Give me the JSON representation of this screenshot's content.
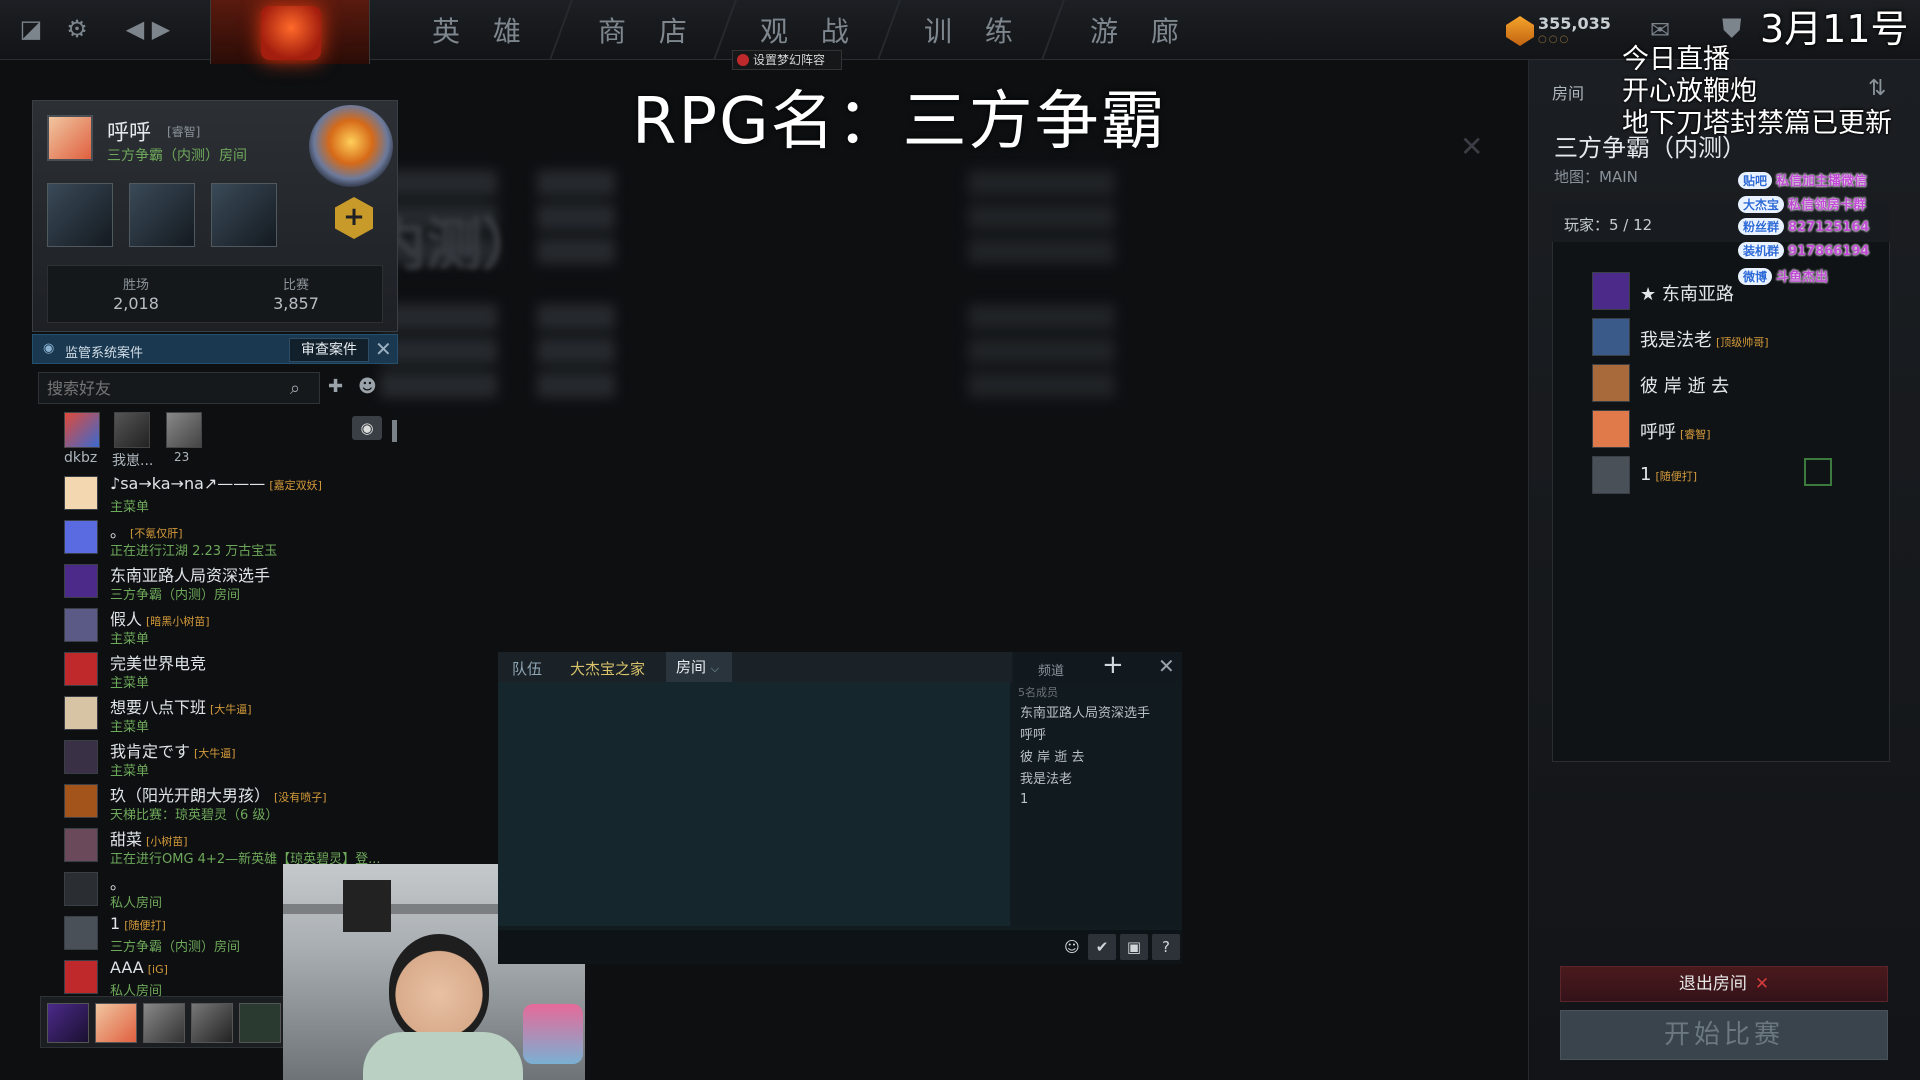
{
  "topbar": {
    "nav": [
      "英 雄",
      "商 店",
      "观 战",
      "训 练",
      "游 廊"
    ],
    "notice": "设置梦幻阵容",
    "currency": "355,035",
    "currency_dots": "○○○"
  },
  "overlay": {
    "date": "3月11号",
    "title": "RPG名：三方争霸",
    "live_lines": [
      "今日直播",
      "开心放鞭炮",
      "地下刀塔封禁篇已更新"
    ]
  },
  "profile": {
    "name": "呼呼",
    "tag": "[睿智]",
    "status": "三方争霸（内测）房间",
    "wins_label": "胜场",
    "wins": "2,018",
    "matches_label": "比赛",
    "matches": "3,857"
  },
  "overwatch": {
    "label": "监管系统案件",
    "button": "审查案件"
  },
  "search": {
    "placeholder": "搜索好友"
  },
  "party": [
    {
      "name": "dkbz"
    },
    {
      "name": "我崽..."
    },
    {
      "name": "23"
    }
  ],
  "friends": [
    {
      "name": "♪sa→ka→na↗———",
      "tag": "[嘉定双妖]",
      "status": "主菜单",
      "color": "#f3d7b0"
    },
    {
      "name": "。",
      "tag": "[不氪仅肝]",
      "status": "正在进行江湖 2.23 万古宝玉",
      "color": "#5a6ae0"
    },
    {
      "name": "东南亚路人局资深选手",
      "tag": "",
      "status": "三方争霸（内测）房间",
      "color": "#4b2a8a"
    },
    {
      "name": "假人",
      "tag": "[暗黑小树苗]",
      "status": "主菜单",
      "color": "#5b5a86"
    },
    {
      "name": "完美世界电竞",
      "tag": "",
      "status": "主菜单",
      "color": "#c0292b"
    },
    {
      "name": "想要八点下班",
      "tag": "[大牛逼]",
      "status": "主菜单",
      "color": "#d6c4a4"
    },
    {
      "name": "我肯定です",
      "tag": "[大牛逼]",
      "status": "主菜单",
      "color": "#3a3046"
    },
    {
      "name": "玖（阳光开朗大男孩）",
      "tag": "[没有喷子]",
      "status": "天梯比赛：琼英碧灵（6 级）",
      "color": "#a2541a"
    },
    {
      "name": "甜菜",
      "tag": "[小树苗]",
      "status": "正在进行OMG 4+2—新英雄【琼英碧灵】登...",
      "color": "#6a4a5a"
    },
    {
      "name": "。",
      "tag": "",
      "status": "私人房间",
      "color": "#2a2e33"
    },
    {
      "name": "1",
      "tag": "[随便打]",
      "status": "三方争霸（内测）房间",
      "color": "#4a5058"
    },
    {
      "name": "AAA",
      "tag": "[iG]",
      "status": "私人房间",
      "color": "#c0292b"
    }
  ],
  "chat": {
    "tabs": [
      "队伍",
      "大杰宝之家"
    ],
    "active_tab": "房间",
    "channel_label": "频道",
    "members_count": "5名成员",
    "members": [
      "东南亚路人局资深选手",
      "呼呼",
      "彼 岸 逝 去",
      "我是法老",
      "1"
    ]
  },
  "room": {
    "label": "房间",
    "name": "三方争霸（内测）",
    "map": "地图：MAIN",
    "players_count": "玩家：5 / 12",
    "players": [
      {
        "name": "★ 东南亚路",
        "tag": "",
        "color": "#4b2a8a"
      },
      {
        "name": "我是法老",
        "tag": "[顶级帅哥]",
        "color": "#3a5a8a"
      },
      {
        "name": "彼 岸 逝 去",
        "tag": "",
        "color": "#a86a3a"
      },
      {
        "name": "呼呼",
        "tag": "[睿智]",
        "color": "#e07a4a"
      },
      {
        "name": "1",
        "tag": "[随便打]",
        "color": "#4a5058"
      }
    ],
    "leave_button": "退出房间",
    "start_button": "开始比赛"
  },
  "badges": [
    {
      "pill": "贴吧",
      "text": "私信加主播微信"
    },
    {
      "pill": "大杰宝",
      "text": "私信领房卡群"
    },
    {
      "pill": "粉丝群",
      "text": "827125164"
    },
    {
      "pill": "装机群",
      "text": "917866194"
    },
    {
      "pill": "微博",
      "text": "斗鱼杰出"
    }
  ]
}
